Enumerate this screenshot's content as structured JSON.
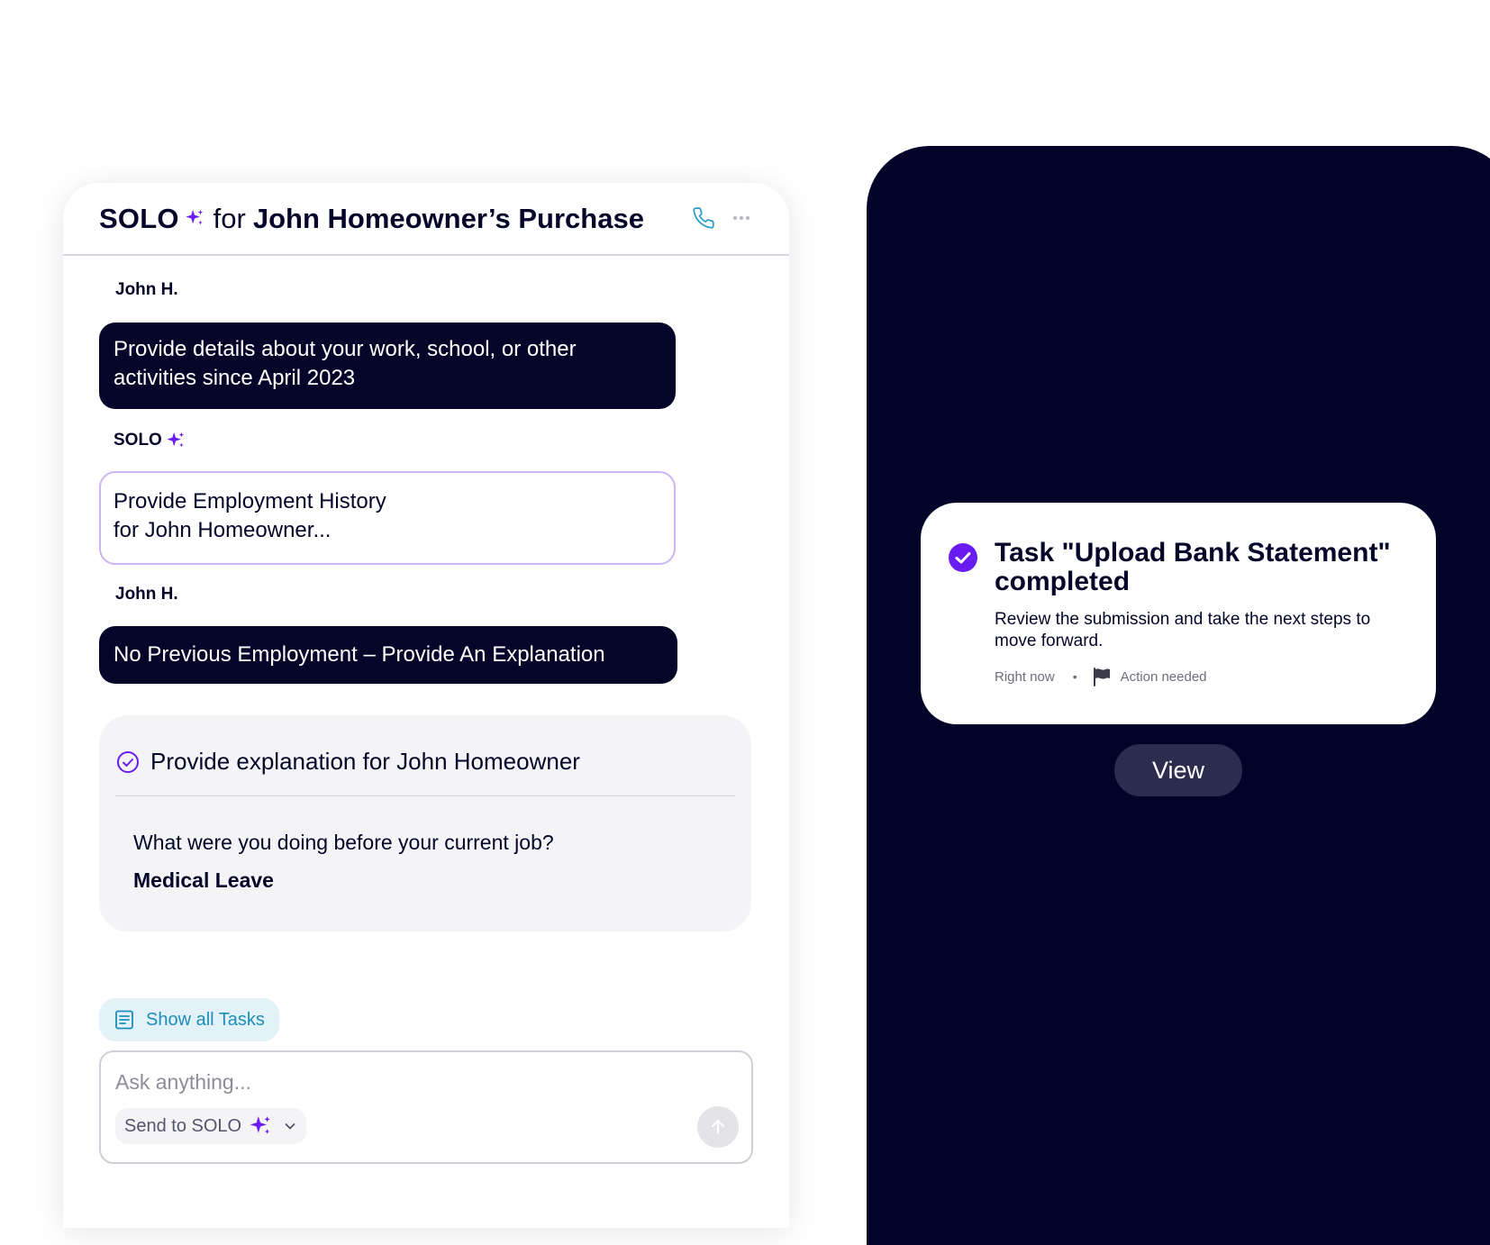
{
  "chat": {
    "brand": "SOLO",
    "title_connector": "for",
    "title_subject": "John Homeowner’s Purchase",
    "phone_icon": "phone-icon",
    "more_icon": "more-horizontal-icon",
    "messages": [
      {
        "sender": "John H.",
        "text": "Provide details about your work, school, or other activities since April 2023"
      },
      {
        "sender": "SOLO",
        "text_line1": "Provide Employment History",
        "text_line2": "for John Homeowner..."
      },
      {
        "sender": "John H.",
        "text": "No Previous Employment – Provide An Explanation"
      }
    ],
    "task": {
      "title": "Provide explanation for John Homeowner",
      "question": "What were you doing before your current job?",
      "answer": "Medical Leave"
    },
    "show_tasks_label": "Show all Tasks",
    "composer": {
      "placeholder": "Ask anything...",
      "send_to_label": "Send to SOLO"
    }
  },
  "notification": {
    "title": "Task \"Upload Bank Statement\" completed",
    "body": "Review the submission and take the next steps to move forward.",
    "time": "Right now",
    "separator": "•",
    "status": "Action needed",
    "view_label": "View"
  },
  "colors": {
    "accent_purple": "#6a1bf2",
    "navy": "#05052a",
    "phone_bg": "#03032a",
    "link_blue": "#1b8fb9",
    "phone_icon_blue": "#2a9bc7"
  }
}
